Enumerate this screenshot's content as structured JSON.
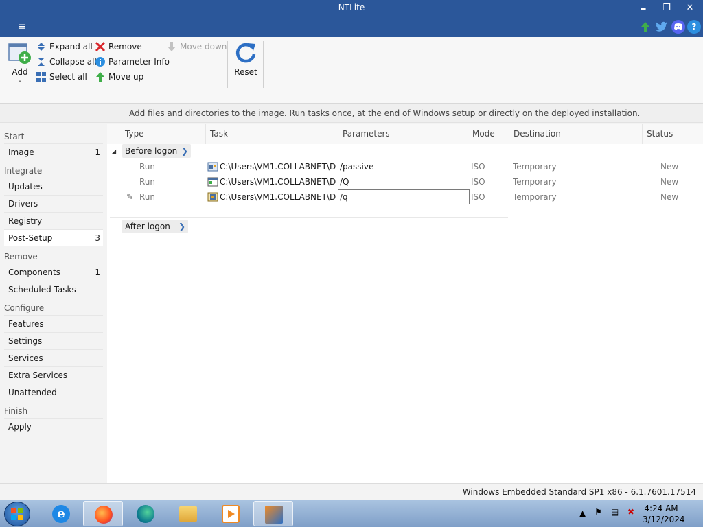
{
  "window": {
    "title": "NTLite",
    "minimize_glyph": "▬",
    "restore_glyph": "❐",
    "close_glyph": "✕"
  },
  "menu": {
    "hamburger_glyph": "≡"
  },
  "social": {
    "icons": [
      "update-arrow-icon",
      "twitter-icon",
      "discord-icon",
      "help-icon"
    ],
    "help_glyph": "?"
  },
  "ribbon": {
    "add_label": "Add",
    "expand_all": "Expand all",
    "collapse_all": "Collapse all",
    "select_all": "Select all",
    "remove": "Remove",
    "parameter_info": "Parameter Info",
    "move_up": "Move up",
    "move_down": "Move down",
    "reset": "Reset"
  },
  "info_text": "Add files and directories to the image. Run tasks once, at the end of Windows setup or directly on the deployed installation.",
  "sidebar": {
    "sections": {
      "start": "Start",
      "integrate": "Integrate",
      "remove": "Remove",
      "configure": "Configure",
      "finish": "Finish"
    },
    "items": {
      "image": {
        "label": "Image",
        "badge": "1"
      },
      "updates": {
        "label": "Updates"
      },
      "drivers": {
        "label": "Drivers"
      },
      "registry": {
        "label": "Registry"
      },
      "postsetup": {
        "label": "Post-Setup",
        "badge": "3"
      },
      "components": {
        "label": "Components",
        "badge": "1"
      },
      "scheduled": {
        "label": "Scheduled Tasks"
      },
      "features": {
        "label": "Features"
      },
      "settings": {
        "label": "Settings"
      },
      "services": {
        "label": "Services"
      },
      "extra_services": {
        "label": "Extra Services"
      },
      "unattended": {
        "label": "Unattended"
      },
      "apply": {
        "label": "Apply"
      }
    }
  },
  "table": {
    "columns": {
      "type": "Type",
      "task": "Task",
      "parameters": "Parameters",
      "mode": "Mode",
      "destination": "Destination",
      "status": "Status"
    },
    "groups": {
      "before": "Before logon",
      "after": "After logon"
    },
    "rows": [
      {
        "type": "Run",
        "task": "C:\\Users\\VM1.COLLABNET\\D...",
        "parameters": "/passive",
        "mode": "ISO",
        "destination": "Temporary",
        "status": "New"
      },
      {
        "type": "Run",
        "task": "C:\\Users\\VM1.COLLABNET\\D...",
        "parameters": "/Q",
        "mode": "ISO",
        "destination": "Temporary",
        "status": "New"
      },
      {
        "type": "Run",
        "task": "C:\\Users\\VM1.COLLABNET\\D...",
        "parameters": "/q",
        "mode": "ISO",
        "destination": "Temporary",
        "status": "New"
      }
    ]
  },
  "statusbar": {
    "text": "Windows Embedded Standard SP1 x86 - 6.1.7601.17514"
  },
  "taskbar": {
    "time": "4:24 AM",
    "date": "3/12/2024",
    "apps": [
      "internet-explorer-icon",
      "firefox-icon",
      "edge-icon",
      "file-explorer-icon",
      "media-player-icon",
      "ntlite-icon"
    ]
  },
  "colors": {
    "titlebar": "#2b579a",
    "accent": "#3a6fb5",
    "remove_red": "#d9262b",
    "move_green": "#3fae49"
  }
}
